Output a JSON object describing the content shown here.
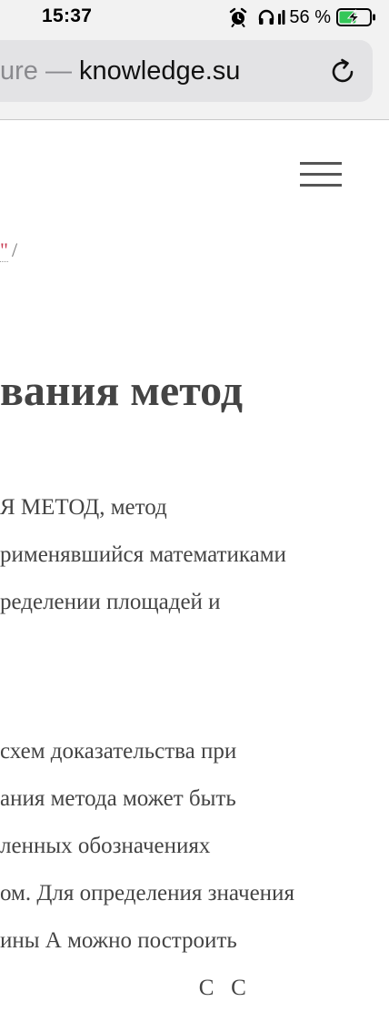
{
  "status_bar": {
    "time": "15:37",
    "battery_percent": "56 %",
    "battery_level": 0.56,
    "charging": true,
    "icons": [
      "alarm-icon",
      "headphones-icon",
      "signal-icon",
      "battery-icon",
      "charging-bolt-icon"
    ]
  },
  "url_bar": {
    "title_fragment": "ure —",
    "domain": "knowledge.su",
    "reload_icon": "reload-icon"
  },
  "nav": {
    "menu_icon": "hamburger-menu-icon"
  },
  "breadcrumb": {
    "link_text": "\"",
    "separator": "/"
  },
  "article": {
    "title": "вания метод",
    "paragraphs": [
      {
        "lines": [
          "Я МЕТОД, метод",
          "рименявшийся математиками",
          "ределении площадей и"
        ]
      },
      {
        "lines": [
          "схем доказательства при",
          "ания метода может быть",
          "ленных обозначениях",
          "ом. Для определения значения",
          "ины А можно построить",
          "                                   С   С"
        ]
      }
    ]
  },
  "colors": {
    "link": "#c73b52",
    "text": "#444444",
    "chrome_bg": "#f2f2f2",
    "battery_green": "#34c759"
  }
}
